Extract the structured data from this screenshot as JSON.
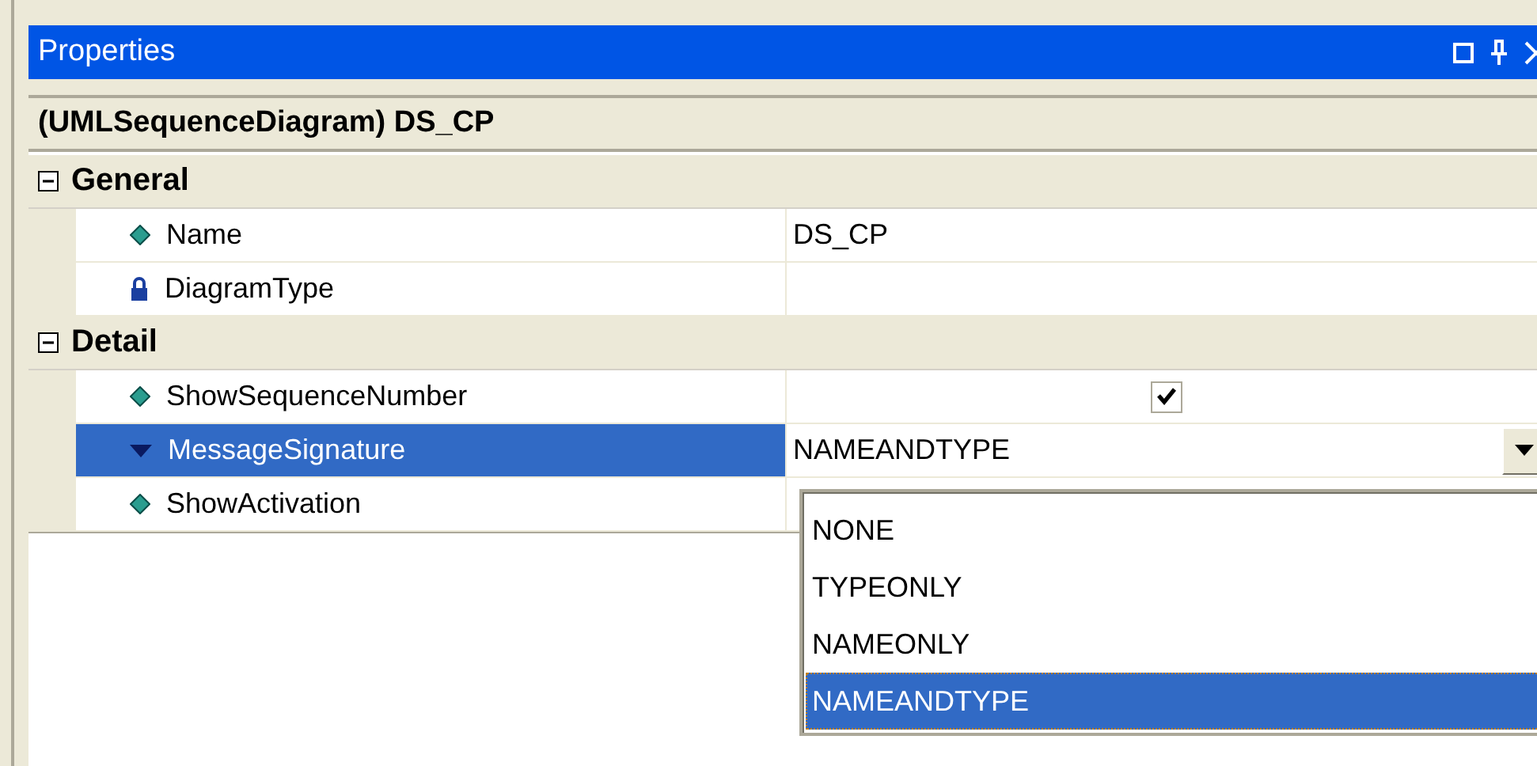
{
  "window": {
    "title": "Properties"
  },
  "object_header": "(UMLSequenceDiagram) DS_CP",
  "categories": [
    {
      "name": "General",
      "expanded": true,
      "properties": [
        {
          "name": "Name",
          "readonly": false,
          "kind": "text",
          "value": "DS_CP",
          "selected": false
        },
        {
          "name": "DiagramType",
          "readonly": true,
          "kind": "text",
          "selected": false
        }
      ]
    },
    {
      "name": "Detail",
      "expanded": true,
      "properties": [
        {
          "name": "ShowSequenceNumber",
          "readonly": false,
          "kind": "checkbox",
          "checked": true,
          "selected": false
        },
        {
          "name": "MessageSignature",
          "readonly": false,
          "kind": "dropdown",
          "value": "NAMEANDTYPE",
          "selected": true,
          "open": true,
          "options": [
            {
              "label": "NONE",
              "selected": false
            },
            {
              "label": "TYPEONLY",
              "selected": false
            },
            {
              "label": "NAMEONLY",
              "selected": false
            },
            {
              "label": "NAMEANDTYPE",
              "selected": true
            }
          ]
        },
        {
          "name": "ShowActivation",
          "readonly": false,
          "kind": "text",
          "selected": false
        }
      ]
    }
  ]
}
